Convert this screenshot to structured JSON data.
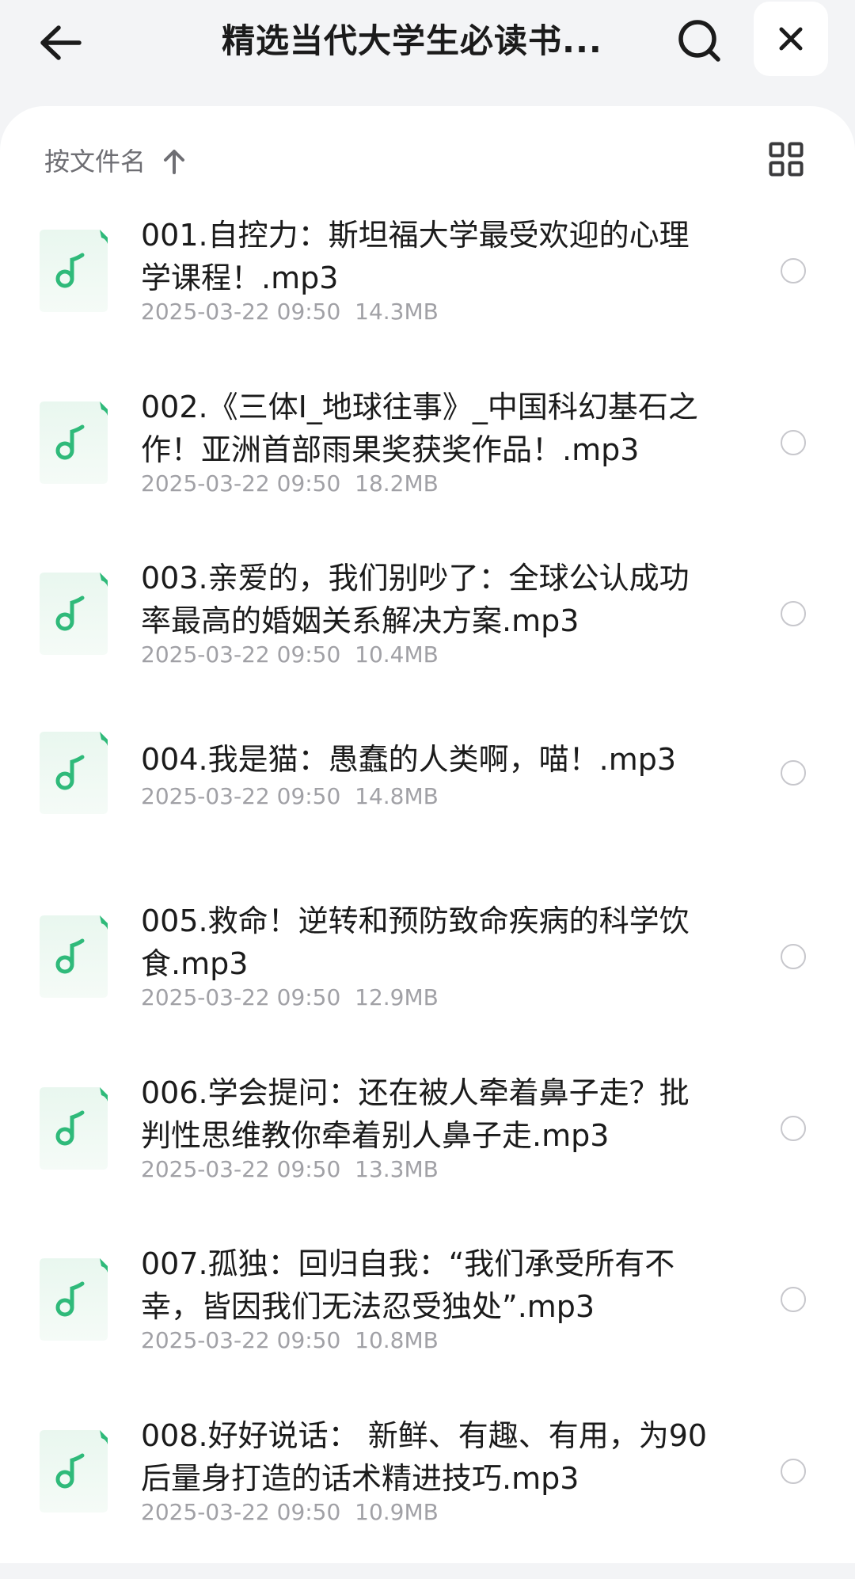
{
  "header": {
    "title": "精选当代大学生必读书...",
    "back_icon": "arrow-left-icon",
    "search_icon": "search-icon",
    "close_icon": "close-icon"
  },
  "sort": {
    "label": "按文件名",
    "direction_icon": "arrow-up-icon",
    "view_toggle_icon": "grid-view-icon"
  },
  "colors": {
    "accent": "#2fba7a",
    "icon_bg": "#e8f6ee",
    "meta": "#a1a1a6"
  },
  "files": [
    {
      "name": "001.自控力：斯坦福大学最受欢迎的心理学课程！.mp3",
      "date": "2025-03-22 09:50",
      "size": "14.3MB",
      "lines": 2
    },
    {
      "name": "002.《三体I_地球往事》_中国科幻基石之作！亚洲首部雨果奖获奖作品！.mp3",
      "date": "2025-03-22 09:50",
      "size": "18.2MB",
      "lines": 2
    },
    {
      "name": "003.亲爱的，我们别吵了：全球公认成功率最高的婚姻关系解决方案.mp3",
      "date": "2025-03-22 09:50",
      "size": "10.4MB",
      "lines": 2
    },
    {
      "name": "004.我是猫：愚蠢的人类啊，喵！.mp3",
      "date": "2025-03-22 09:50",
      "size": "14.8MB",
      "lines": 1
    },
    {
      "name": "005.救命！逆转和预防致命疾病的科学饮食.mp3",
      "date": "2025-03-22 09:50",
      "size": "12.9MB",
      "lines": 2
    },
    {
      "name": "006.学会提问：还在被人牵着鼻子走？批判性思维教你牵着别人鼻子走.mp3",
      "date": "2025-03-22 09:50",
      "size": "13.3MB",
      "lines": 2
    },
    {
      "name": "007.孤独：回归自我：“我们承受所有不幸，皆因我们无法忍受独处”.mp3",
      "date": "2025-03-22 09:50",
      "size": "10.8MB",
      "lines": 2
    },
    {
      "name": "008.好好说话： 新鲜、有趣、有用，为90后量身打造的话术精进技巧.mp3",
      "date": "2025-03-22 09:50",
      "size": "10.9MB",
      "lines": 2
    }
  ]
}
